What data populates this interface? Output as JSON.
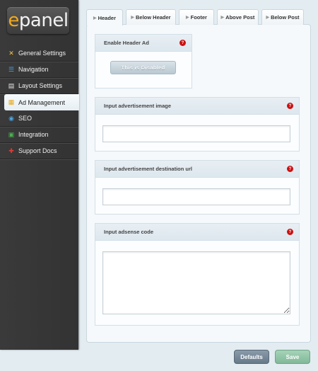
{
  "logo": {
    "e": "e",
    "rest": "panel"
  },
  "nav": [
    {
      "label": "General Settings",
      "icon": "general-settings-icon",
      "active": false
    },
    {
      "label": "Navigation",
      "icon": "navigation-icon",
      "active": false
    },
    {
      "label": "Layout Settings",
      "icon": "layout-settings-icon",
      "active": false
    },
    {
      "label": "Ad Management",
      "icon": "ad-management-icon",
      "active": true
    },
    {
      "label": "SEO",
      "icon": "seo-icon",
      "active": false
    },
    {
      "label": "Integration",
      "icon": "integration-icon",
      "active": false
    },
    {
      "label": "Support Docs",
      "icon": "support-docs-icon",
      "active": false
    }
  ],
  "tabs": [
    {
      "label": "Header",
      "active": true
    },
    {
      "label": "Below Header",
      "active": false
    },
    {
      "label": "Footer",
      "active": false
    },
    {
      "label": "Above Post",
      "active": false
    },
    {
      "label": "Below Post",
      "active": false
    }
  ],
  "sections": {
    "enable_header_ad": {
      "title": "Enable Header Ad",
      "toggle_label": "This is Disabled"
    },
    "ad_image": {
      "title": "Input advertisement image",
      "value": ""
    },
    "ad_url": {
      "title": "Input advertisement destination url",
      "value": ""
    },
    "adsense": {
      "title": "Input adsense code",
      "value": ""
    }
  },
  "help_glyph": "?",
  "buttons": {
    "defaults": "Defaults",
    "save": "Save"
  },
  "colors": {
    "accent_orange": "#f2a91d",
    "help_red": "#cc1111",
    "save_green": "#80b898",
    "defaults_slate": "#66798a"
  }
}
